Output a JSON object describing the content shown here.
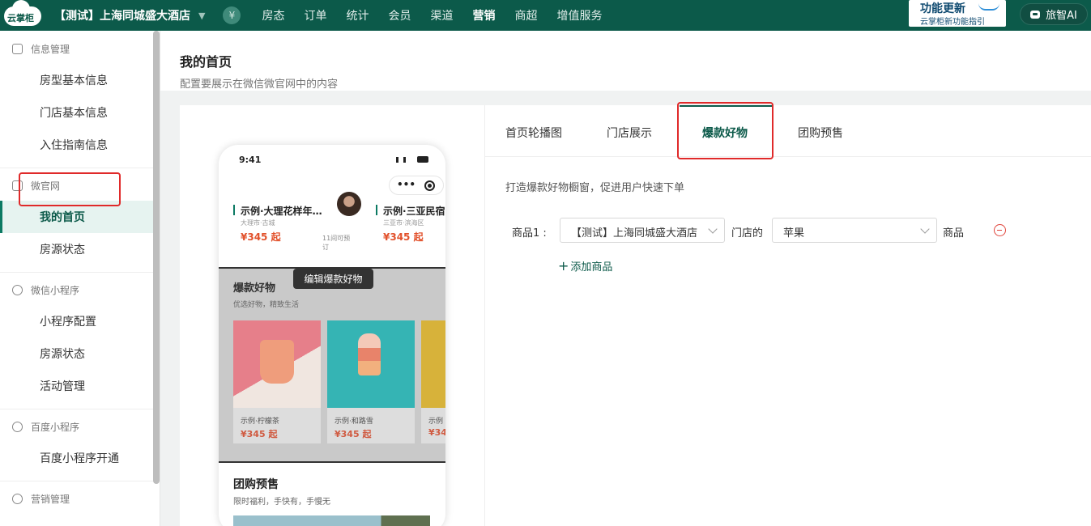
{
  "topbar": {
    "logo_text": "云掌柜",
    "store": "【测试】上海同城盛大酒店",
    "currency_symbol": "¥",
    "nav": [
      "房态",
      "订单",
      "统计",
      "会员",
      "渠道",
      "营销",
      "商超",
      "增值服务"
    ],
    "active_nav": "营销",
    "update_title": "功能更新",
    "update_sub": "云掌柜新功能指引",
    "ai_label": "旅智AI"
  },
  "sidebar": {
    "groups": [
      {
        "label": "信息管理",
        "items": [
          "房型基本信息",
          "门店基本信息",
          "入住指南信息"
        ]
      },
      {
        "label": "微官网",
        "items": [
          "我的首页",
          "房源状态"
        ]
      },
      {
        "label": "微信小程序",
        "items": [
          "小程序配置",
          "房源状态",
          "活动管理"
        ]
      },
      {
        "label": "百度小程序",
        "items": [
          "百度小程序开通"
        ]
      },
      {
        "label": "营销管理",
        "items": []
      }
    ],
    "active_item": "我的首页"
  },
  "page": {
    "title": "我的首页",
    "subtitle": "配置要展示在微信微官网中的内容"
  },
  "preview": {
    "time": "9:41",
    "capsule_dots": "•••",
    "hotel_cards": [
      {
        "name": "示例·大理花样年华...",
        "location": "大理市·古城",
        "price": "¥345 起",
        "avail": "11间可预订"
      },
      {
        "name": "示例·三亚民宿",
        "location": "三亚市·滨海区",
        "price": "¥345 起",
        "avail": ""
      }
    ],
    "hot_section": {
      "title": "爆款好物",
      "subtitle": "优选好物，精致生活",
      "products": [
        {
          "name": "示例·柠檬茶",
          "price": "¥345 起"
        },
        {
          "name": "示例·和路雪",
          "price": "¥345 起"
        },
        {
          "name": "示例",
          "price": "¥34"
        }
      ]
    },
    "edit_tooltip": "编辑爆款好物",
    "group_section": {
      "title": "团购预售",
      "subtitle": "限时福利，手快有，手慢无"
    }
  },
  "config": {
    "tabs": [
      "首页轮播图",
      "门店展示",
      "爆款好物",
      "团购预售"
    ],
    "active_tab": "爆款好物",
    "description": "打造爆款好物橱窗，促进用户快速下单",
    "product_row": {
      "label": "商品1 :",
      "store_select": "【测试】上海同城盛大酒店",
      "mid_label": "门店的",
      "product_select": "苹果",
      "end_label": "商品"
    },
    "add_label": "添加商品"
  }
}
